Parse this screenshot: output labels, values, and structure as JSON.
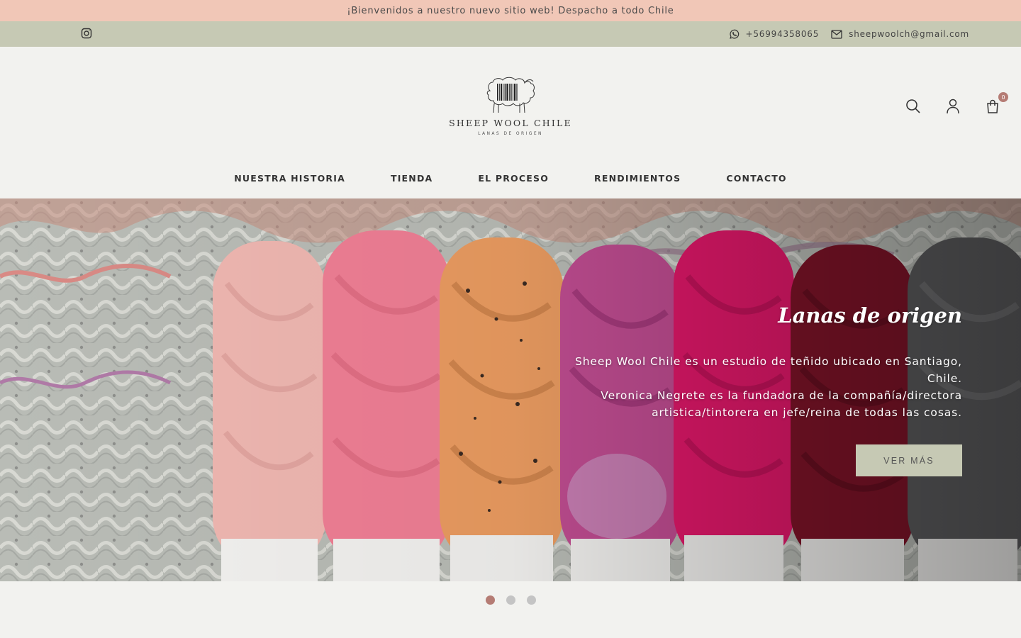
{
  "announcement": "¡Bienvenidos a nuestro nuevo sitio web! Despacho a todo Chile",
  "topbar": {
    "social_icon": "instagram-icon",
    "phone": "+56994358065",
    "phone_icon": "whatsapp-icon",
    "email": "sheepwoolch@gmail.com",
    "email_icon": "envelope-icon"
  },
  "header": {
    "brand_name": "SHEEP WOOL CHILE",
    "brand_tagline": "LANAS DE ORIGEN",
    "icons": [
      "search-icon",
      "user-icon",
      "shopping-bag-icon"
    ],
    "cart_count": "0"
  },
  "nav": [
    {
      "label": "NUESTRA HISTORIA"
    },
    {
      "label": "TIENDA"
    },
    {
      "label": "EL PROCESO"
    },
    {
      "label": "RENDIMIENTOS"
    },
    {
      "label": "CONTACTO"
    }
  ],
  "hero": {
    "title": "Lanas de origen",
    "line1": "Sheep Wool Chile es un estudio de teñido ubicado en Santiago, Chile.",
    "line2": "Veronica Negrete es la fundadora de la compañía/directora artistica/tintorera en jefe/reina de todas las cosas.",
    "button": "VER MÁS"
  },
  "slider": {
    "total": 3,
    "active": 1
  },
  "colors": {
    "announcement_bg": "#f1c7b7",
    "topbar_bg": "#c6c9b4",
    "page_bg": "#f2f2ef",
    "accent": "#b57c74",
    "button_bg": "#c6c9b4"
  }
}
